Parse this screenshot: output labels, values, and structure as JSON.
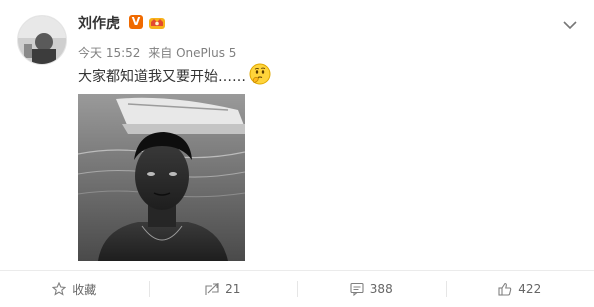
{
  "post": {
    "username": "刘作虎",
    "verified_badge": "V",
    "verified_color": "#f06a00",
    "crown_icon": "crown-icon",
    "time": "今天 15:52",
    "source_prefix": "来自",
    "source_device": "OnePlus 5",
    "text": "大家都知道我又要开始……",
    "emoji_icon": "thinking-face-icon"
  },
  "actions": {
    "favorite_label": "收藏",
    "repost_count": "21",
    "comment_count": "388",
    "like_count": "422"
  }
}
